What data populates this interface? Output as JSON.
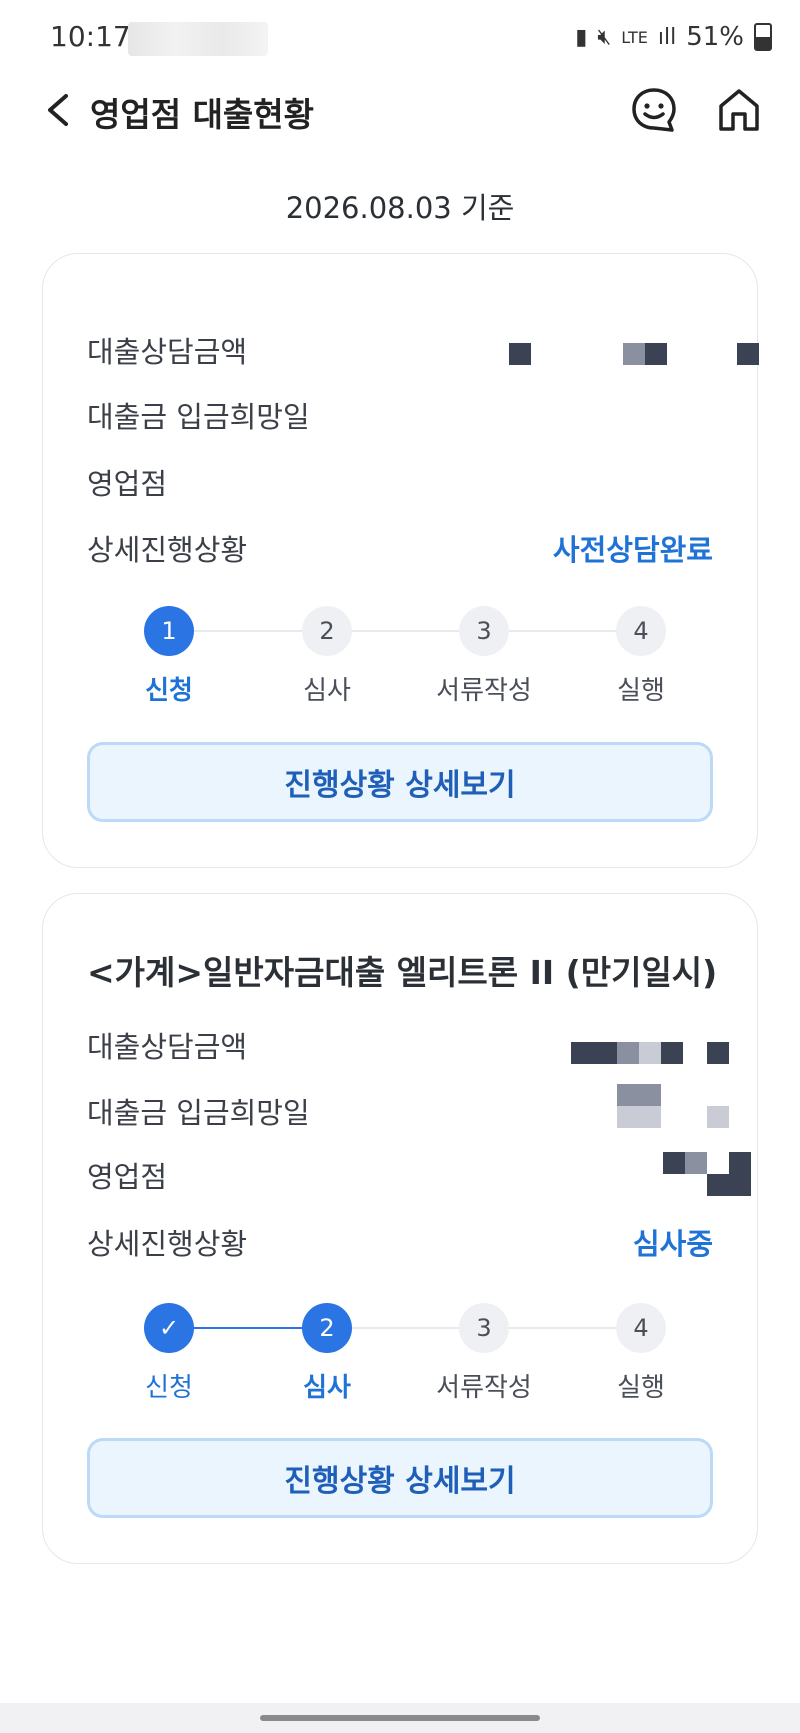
{
  "status_bar": {
    "time": "10:17",
    "network": "LTE",
    "battery": "51%"
  },
  "header": {
    "title": "영업점 대출현황",
    "back_icon": "chevron-left-icon",
    "chat_icon": "chat-bot-icon",
    "home_icon": "home-icon"
  },
  "basis_date": "2026.08.03 기준",
  "cards": [
    {
      "rows": {
        "amount_label": "대출상담금액",
        "date_label": "대출금 입금희망일",
        "branch_label": "영업점",
        "status_label": "상세진행상황",
        "status_value": "사전상담완료"
      },
      "steps": [
        {
          "num": "1",
          "label": "신청"
        },
        {
          "num": "2",
          "label": "심사"
        },
        {
          "num": "3",
          "label": "서류작성"
        },
        {
          "num": "4",
          "label": "실행"
        }
      ],
      "button": "진행상황 상세보기"
    },
    {
      "product": "<가계>일반자금대출 엘리트론 II (만기일시)",
      "rows": {
        "amount_label": "대출상담금액",
        "date_label": "대출금 입금희망일",
        "branch_label": "영업점",
        "status_label": "상세진행상황",
        "status_value": "심사중"
      },
      "steps": [
        {
          "num": "✓",
          "label": "신청"
        },
        {
          "num": "2",
          "label": "심사"
        },
        {
          "num": "3",
          "label": "서류작성"
        },
        {
          "num": "4",
          "label": "실행"
        }
      ],
      "button": "진행상황 상세보기"
    }
  ],
  "colors": {
    "accent": "#2b74e3",
    "button_bg": "#eaf5fe",
    "button_border": "#bcd9f6"
  }
}
